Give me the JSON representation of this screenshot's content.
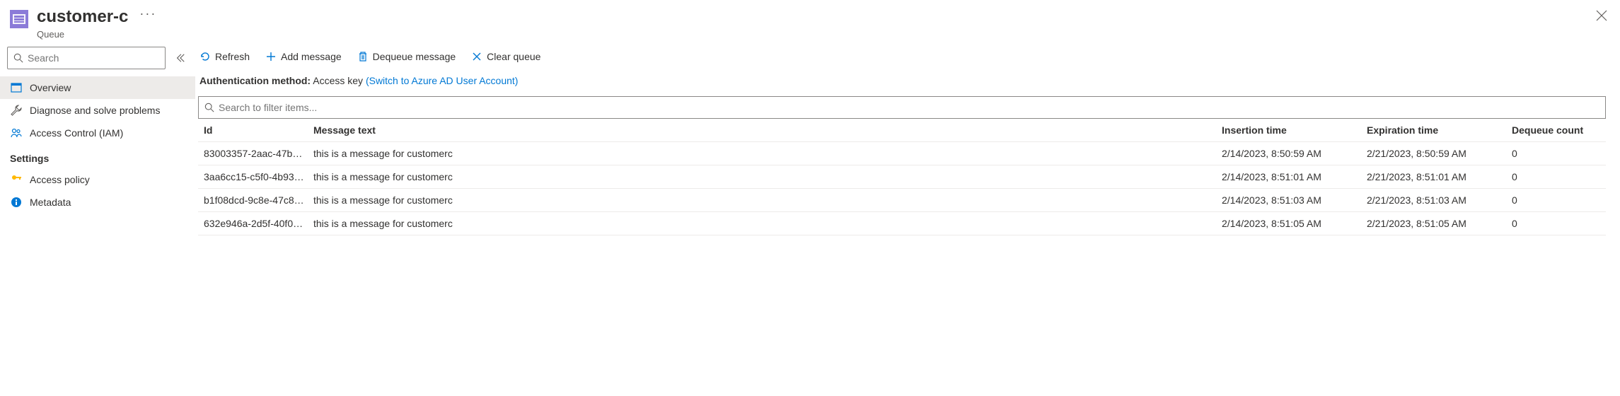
{
  "header": {
    "title": "customer-c",
    "subtitle": "Queue",
    "more": "···"
  },
  "sidebar": {
    "search_placeholder": "Search",
    "items": [
      {
        "label": "Overview"
      },
      {
        "label": "Diagnose and solve problems"
      },
      {
        "label": "Access Control (IAM)"
      }
    ],
    "settings_label": "Settings",
    "settings_items": [
      {
        "label": "Access policy"
      },
      {
        "label": "Metadata"
      }
    ]
  },
  "toolbar": {
    "refresh": "Refresh",
    "add_message": "Add message",
    "dequeue_message": "Dequeue message",
    "clear_queue": "Clear queue"
  },
  "auth": {
    "label": "Authentication method:",
    "value": "Access key",
    "link": "(Switch to Azure AD User Account)"
  },
  "filter": {
    "placeholder": "Search to filter items..."
  },
  "table": {
    "headers": {
      "id": "Id",
      "message": "Message text",
      "insertion": "Insertion time",
      "expiration": "Expiration time",
      "dequeue": "Dequeue count"
    },
    "rows": [
      {
        "id": "83003357-2aac-47b…",
        "message": "this is a message for customerc",
        "insertion": "2/14/2023, 8:50:59 AM",
        "expiration": "2/21/2023, 8:50:59 AM",
        "dequeue": "0"
      },
      {
        "id": "3aa6cc15-c5f0-4b93…",
        "message": "this is a message for customerc",
        "insertion": "2/14/2023, 8:51:01 AM",
        "expiration": "2/21/2023, 8:51:01 AM",
        "dequeue": "0"
      },
      {
        "id": "b1f08dcd-9c8e-47c8…",
        "message": "this is a message for customerc",
        "insertion": "2/14/2023, 8:51:03 AM",
        "expiration": "2/21/2023, 8:51:03 AM",
        "dequeue": "0"
      },
      {
        "id": "632e946a-2d5f-40f0…",
        "message": "this is a message for customerc",
        "insertion": "2/14/2023, 8:51:05 AM",
        "expiration": "2/21/2023, 8:51:05 AM",
        "dequeue": "0"
      }
    ]
  }
}
